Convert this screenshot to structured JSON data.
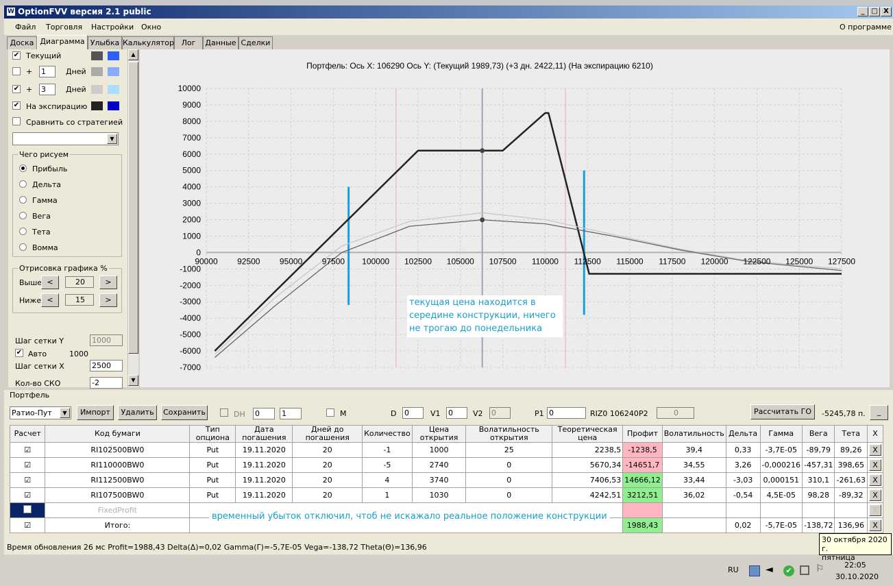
{
  "window": {
    "title": "OptionFVV версия 2.1 public",
    "min": "_",
    "max": "□",
    "close": "X"
  },
  "menu": {
    "file": "Файл",
    "trade": "Торговля",
    "settings": "Настройки",
    "window": "Окно",
    "about": "О программе"
  },
  "tabs": [
    "Доска",
    "Диаграмма",
    "Улыбка",
    "Калькулятор",
    "Лог",
    "Данные",
    "Сделки"
  ],
  "left": {
    "current": "Текущий",
    "plus": "+",
    "days1": "1",
    "days3": "3",
    "days_label": "Дней",
    "expiry": "На экспирацию",
    "compare": "Сравнить со стратегией",
    "what_title": "Чего рисуем",
    "radios": [
      "Прибыль",
      "Дельта",
      "Гамма",
      "Вега",
      "Тета",
      "Вомма"
    ],
    "draw_title": "Отрисовка графика %",
    "above": "Выше",
    "above_val": "20",
    "below": "Ниже",
    "below_val": "15",
    "lt": "<",
    "gt": ">",
    "grid_y": "Шаг сетки Y",
    "grid_y_val": "1000",
    "auto": "Авто",
    "auto_val": "1000",
    "grid_x": "Шаг сетки X",
    "grid_x_val": "2500",
    "sko": "Кол-во СКО",
    "sko_val": "-2",
    "colors": {
      "current_a": "#555555",
      "current_b": "#2b60ff",
      "d1_a": "#aaaaaa",
      "d1_b": "#88aaff",
      "d3_a": "#cccccc",
      "d3_b": "#aaddff",
      "exp_a": "#222222",
      "exp_b": "#0000c8"
    }
  },
  "chart_data": {
    "type": "line",
    "title": "Портфель: Ось X:  106290 Ось Y:   (Текущий 1989,73)  (+3 дн. 2422,11)  (На экспирацию 6210)",
    "xlim": [
      90000,
      127500
    ],
    "ylim": [
      -7000,
      10000
    ],
    "x_ticks": [
      "90000",
      "92500",
      "95000",
      "97500",
      "100000",
      "102500",
      "105000",
      "107500",
      "110000",
      "112500",
      "115000",
      "117500",
      "120000",
      "122500",
      "125000",
      "127500"
    ],
    "y_ticks": [
      "10000",
      "9000",
      "8000",
      "7000",
      "6000",
      "5000",
      "4000",
      "3000",
      "2000",
      "1000",
      "0",
      "-1000",
      "-2000",
      "-3000",
      "-4000",
      "-5000",
      "-6000",
      "-7000"
    ],
    "current_price": 106290,
    "pink_lines": [
      101200,
      111200
    ],
    "blue_bars": [
      {
        "x": 98400,
        "y0": -3200,
        "y1": 4000
      },
      {
        "x": 112300,
        "y0": -3800,
        "y1": 5000
      }
    ],
    "series": [
      {
        "name": "На экспирацию",
        "color": "#222222",
        "x": [
          90500,
          102500,
          107500,
          110000,
          110200,
          112600,
          127500
        ],
        "y": [
          -6000,
          6210,
          6210,
          8500,
          8500,
          -1300,
          -1300
        ]
      },
      {
        "name": "+3 дн.",
        "color": "#c8c8c8",
        "x": [
          90500,
          94000,
          98000,
          102000,
          106290,
          110000,
          114000,
          118000,
          122000,
          127500
        ],
        "y": [
          -6200,
          -2800,
          400,
          1900,
          2422,
          2000,
          1100,
          200,
          -500,
          -1000
        ]
      },
      {
        "name": "Текущий",
        "color": "#666666",
        "x": [
          90500,
          94000,
          98000,
          102000,
          106290,
          110000,
          114000,
          118000,
          122000,
          127500
        ],
        "y": [
          -6400,
          -3300,
          0,
          1600,
          1990,
          1750,
          1000,
          150,
          -550,
          -1100
        ]
      }
    ],
    "markers": [
      {
        "x": 106290,
        "y": 6210
      },
      {
        "x": 106290,
        "y": 1990
      }
    ]
  },
  "annotations": {
    "chart_note": "текущая цена находится в середине конструкции, ничего не трогаю до понедельника",
    "table_note": "временный убыток отключил, чтоб не искажало реальное положение конструкции"
  },
  "portfolio": {
    "title": "Портфель",
    "strategy": "Ратио-Пут",
    "import": "Импорт",
    "delete": "Удалить",
    "save": "Сохранить",
    "dh": "DH",
    "dh_a": "0",
    "dh_b": "1",
    "m": "M",
    "d": "D",
    "d_val": "0",
    "v1": "V1",
    "v1_val": "0",
    "v2": "V2",
    "v2_val": "0",
    "p1": "P1",
    "p1_val": "0",
    "riz": "RIZ0 106240",
    "p2": "P2",
    "p2_val": "0",
    "calc_go": "Рассчитать ГО",
    "go_value": "-5245,78 п.",
    "min_btn": "_"
  },
  "table": {
    "headers": [
      "Расчет",
      "Код бумаги",
      "Тип опциона",
      "Дата погашения",
      "Дней до погашения",
      "Количество",
      "Цена открытия",
      "Волатильность открытия",
      "Теоретическая цена",
      "Профит",
      "Волатильность",
      "Дельта",
      "Гамма",
      "Вега",
      "Тета",
      "X"
    ],
    "rows": [
      {
        "code": "RI102500BW0",
        "type": "Put",
        "date": "19.11.2020",
        "days": "20",
        "qty": "-1",
        "price": "1000",
        "vol_open": "25",
        "theor": "2238,5",
        "profit": "-1238,5",
        "vol": "39,4",
        "delta": "0,33",
        "gamma": "-3,7E-05",
        "vega": "-89,79",
        "theta": "89,26",
        "x": "X"
      },
      {
        "code": "RI110000BW0",
        "type": "Put",
        "date": "19.11.2020",
        "days": "20",
        "qty": "-5",
        "price": "2740",
        "vol_open": "0",
        "theor": "5670,34",
        "profit": "-14651,7",
        "vol": "34,55",
        "delta": "3,26",
        "gamma": "-0,000216",
        "vega": "-457,31",
        "theta": "398,65",
        "x": "X"
      },
      {
        "code": "RI112500BW0",
        "type": "Put",
        "date": "19.11.2020",
        "days": "20",
        "qty": "4",
        "price": "3740",
        "vol_open": "0",
        "theor": "7406,53",
        "profit": "14666,12",
        "vol": "33,44",
        "delta": "-3,03",
        "gamma": "0,000151",
        "vega": "310,1",
        "theta": "-261,63",
        "x": "X"
      },
      {
        "code": "RI107500BW0",
        "type": "Put",
        "date": "19.11.2020",
        "days": "20",
        "qty": "1",
        "price": "1030",
        "vol_open": "0",
        "theor": "4242,51",
        "profit": "3212,51",
        "vol": "36,02",
        "delta": "-0,54",
        "gamma": "4,5E-05",
        "vega": "98,28",
        "theta": "-89,32",
        "x": "X"
      }
    ],
    "fixed": "FixedProfit",
    "total_label": "Итого:",
    "total": {
      "profit": "1988,43",
      "delta": "0,02",
      "gamma": "-5,7E-05",
      "vega": "-138,72",
      "theta": "136,96",
      "x": "X"
    }
  },
  "status": "Время обновления 26 мс  Profit=1988,43 Delta(Δ)=0,02 Gamma(Γ)=-5,7E-05 Vega=-138,72 Theta(Θ)=136,96",
  "tooltip": {
    "line1": "30 октября 2020 г.",
    "line2": "пятница"
  },
  "tray": {
    "lang": "RU",
    "time": "22:05",
    "date": "30.10.2020"
  }
}
